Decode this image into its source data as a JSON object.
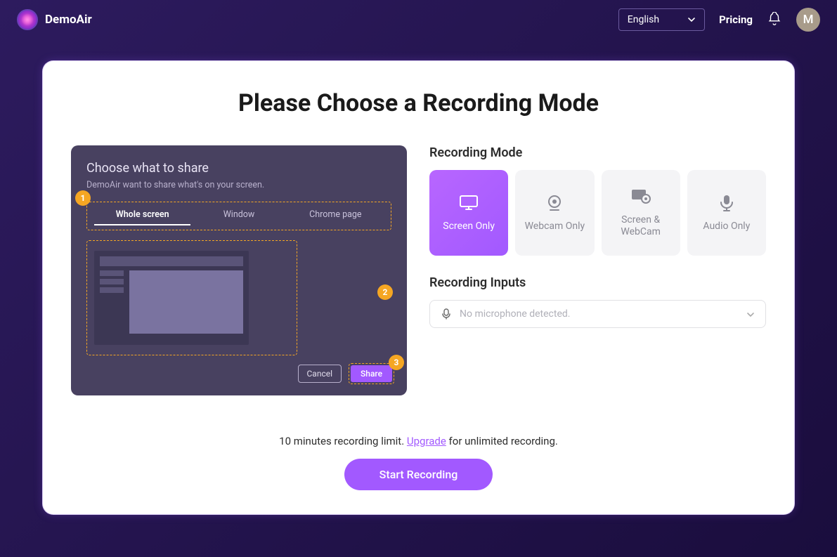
{
  "header": {
    "brand": "DemoAir",
    "language": "English",
    "pricing": "Pricing",
    "avatar_initial": "M"
  },
  "main": {
    "title": "Please Choose a Recording Mode"
  },
  "share_preview": {
    "title": "Choose what to share",
    "subtitle": "DemoAir want to share what's on your screen.",
    "tabs": [
      {
        "label": "Whole screen",
        "active": true
      },
      {
        "label": "Window",
        "active": false
      },
      {
        "label": "Chrome page",
        "active": false
      }
    ],
    "steps": {
      "1": "1",
      "2": "2",
      "3": "3"
    },
    "cancel": "Cancel",
    "share": "Share"
  },
  "recording_mode": {
    "label": "Recording Mode",
    "options": [
      {
        "label": "Screen Only",
        "icon": "monitor",
        "active": true
      },
      {
        "label": "Webcam Only",
        "icon": "webcam",
        "active": false
      },
      {
        "label": "Screen & WebCam",
        "icon": "screen-webcam",
        "active": false
      },
      {
        "label": "Audio Only",
        "icon": "mic",
        "active": false
      }
    ]
  },
  "recording_inputs": {
    "label": "Recording Inputs",
    "placeholder": "No microphone detected."
  },
  "footer": {
    "limit_pre": "10 minutes recording limit. ",
    "upgrade": "Upgrade",
    "limit_post": " for unlimited recording.",
    "start": "Start Recording"
  }
}
